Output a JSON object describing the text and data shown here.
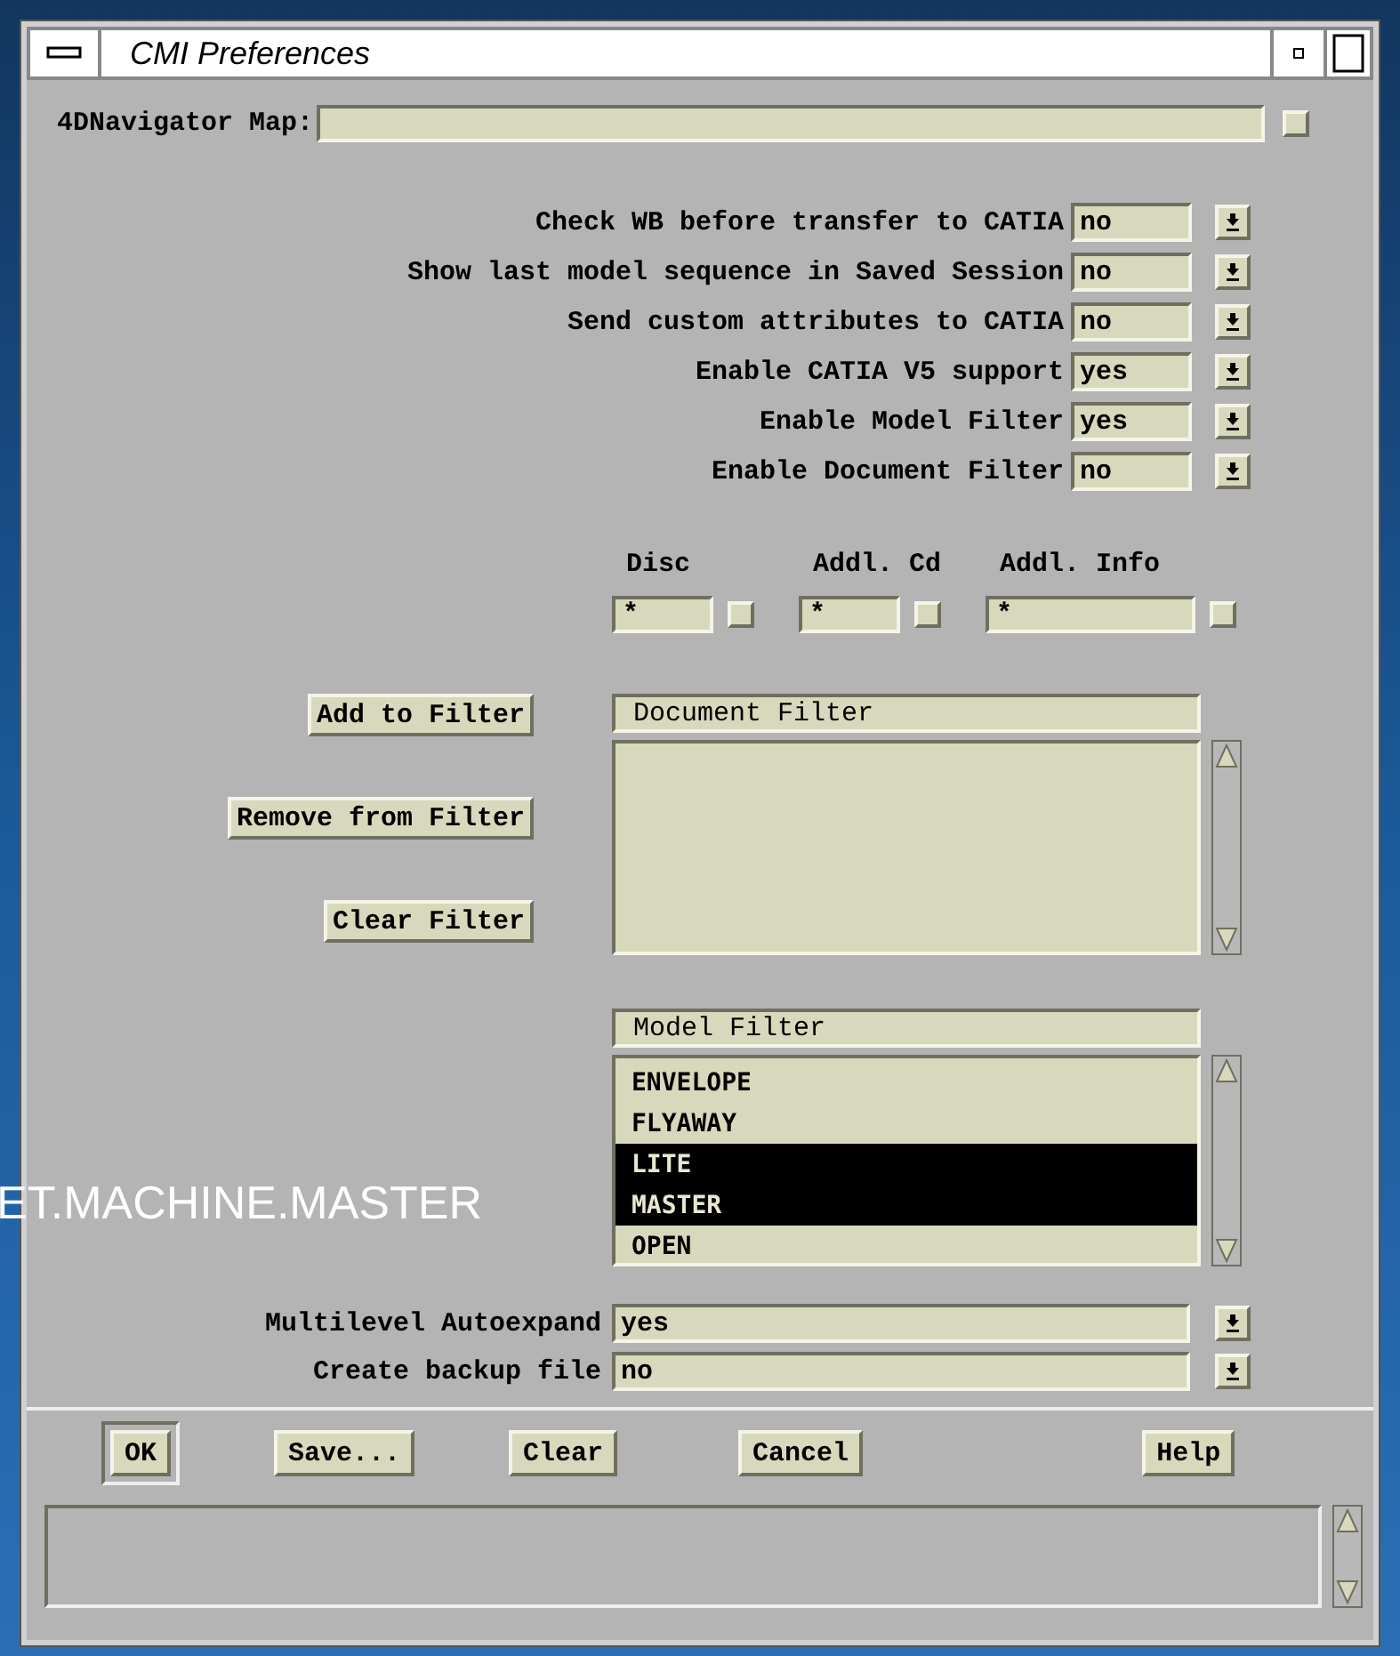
{
  "window": {
    "title": "CMI Preferences"
  },
  "navigator_map": {
    "label": "4DNavigator Map:"
  },
  "options": [
    {
      "label": "Check WB before transfer to CATIA",
      "value": "no"
    },
    {
      "label": "Show last model sequence in Saved Session",
      "value": "no"
    },
    {
      "label": "Send custom attributes to CATIA",
      "value": "no"
    },
    {
      "label": "Enable CATIA V5 support",
      "value": "yes"
    },
    {
      "label": "Enable Model Filter",
      "value": "yes"
    },
    {
      "label": "Enable Document Filter",
      "value": "no"
    }
  ],
  "filter_fields": [
    {
      "label": "Disc",
      "value": "*",
      "kind": "short"
    },
    {
      "label": "Addl. Cd",
      "value": "*",
      "kind": "short"
    },
    {
      "label": "Addl. Info",
      "value": "*",
      "kind": "wide"
    }
  ],
  "filter_buttons": [
    "Add to Filter",
    "Remove from Filter",
    "Clear Filter"
  ],
  "document_filter": {
    "title": "Document Filter"
  },
  "model_filter": {
    "title": "Model Filter",
    "items": [
      {
        "label": "ENVELOPE",
        "selected": false
      },
      {
        "label": "FLYAWAY",
        "selected": false
      },
      {
        "label": "LITE",
        "selected": true
      },
      {
        "label": "MASTER",
        "selected": true
      },
      {
        "label": "OPEN",
        "selected": false
      }
    ]
  },
  "bottom_options": [
    {
      "label": "Multilevel Autoexpand",
      "value": "yes"
    },
    {
      "label": "Create backup file",
      "value": "no"
    }
  ],
  "buttons": [
    {
      "label": "OK",
      "default": true
    },
    {
      "label": "Save...",
      "default": false
    },
    {
      "label": "Clear",
      "default": false
    },
    {
      "label": "Cancel",
      "default": false
    },
    {
      "label": "Help",
      "default": false
    }
  ],
  "overlay_text": "ET.MACHINE.MASTER"
}
